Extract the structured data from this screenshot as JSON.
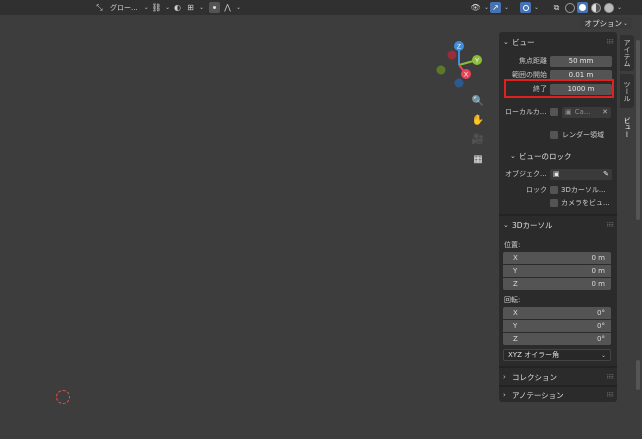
{
  "header": {
    "orientation_label": "グロー...",
    "options_label": "オプション"
  },
  "gizmo": {
    "x": "X",
    "y": "Y",
    "z": "Z"
  },
  "tabs": [
    "アイテム",
    "ツール",
    "ビュー"
  ],
  "view_section": {
    "title": "ビュー",
    "focal_length_label": "焦点距離",
    "focal_length_value": "50 mm",
    "clip_start_label": "範囲の開始",
    "clip_start_value": "0.01 m",
    "clip_end_label": "終了",
    "clip_end_value": "1000 m",
    "local_camera_label": "ローカルカ...",
    "local_camera_value": "Ca...",
    "render_region_label": "レンダー領域"
  },
  "view_lock": {
    "title": "ビューのロック",
    "object_label": "オブジェク...",
    "lock_label": "ロック",
    "lock_cursor_label": "3Dカーソル...",
    "lock_camera_label": "カメラをビュ..."
  },
  "cursor_section": {
    "title": "3Dカーソル",
    "location_label": "位置:",
    "location": [
      {
        "axis": "X",
        "value": "0 m"
      },
      {
        "axis": "Y",
        "value": "0 m"
      },
      {
        "axis": "Z",
        "value": "0 m"
      }
    ],
    "rotation_label": "回転:",
    "rotation": [
      {
        "axis": "X",
        "value": "0°"
      },
      {
        "axis": "Y",
        "value": "0°"
      },
      {
        "axis": "Z",
        "value": "0°"
      }
    ],
    "rotation_mode": "XYZ オイラー角"
  },
  "collapsed_sections": [
    "コレクション",
    "アノテーション"
  ],
  "colors": {
    "highlight": "#e22020",
    "x_axis": "#e8455a",
    "y_axis": "#8bbd3a",
    "z_axis": "#3c8ee0"
  }
}
